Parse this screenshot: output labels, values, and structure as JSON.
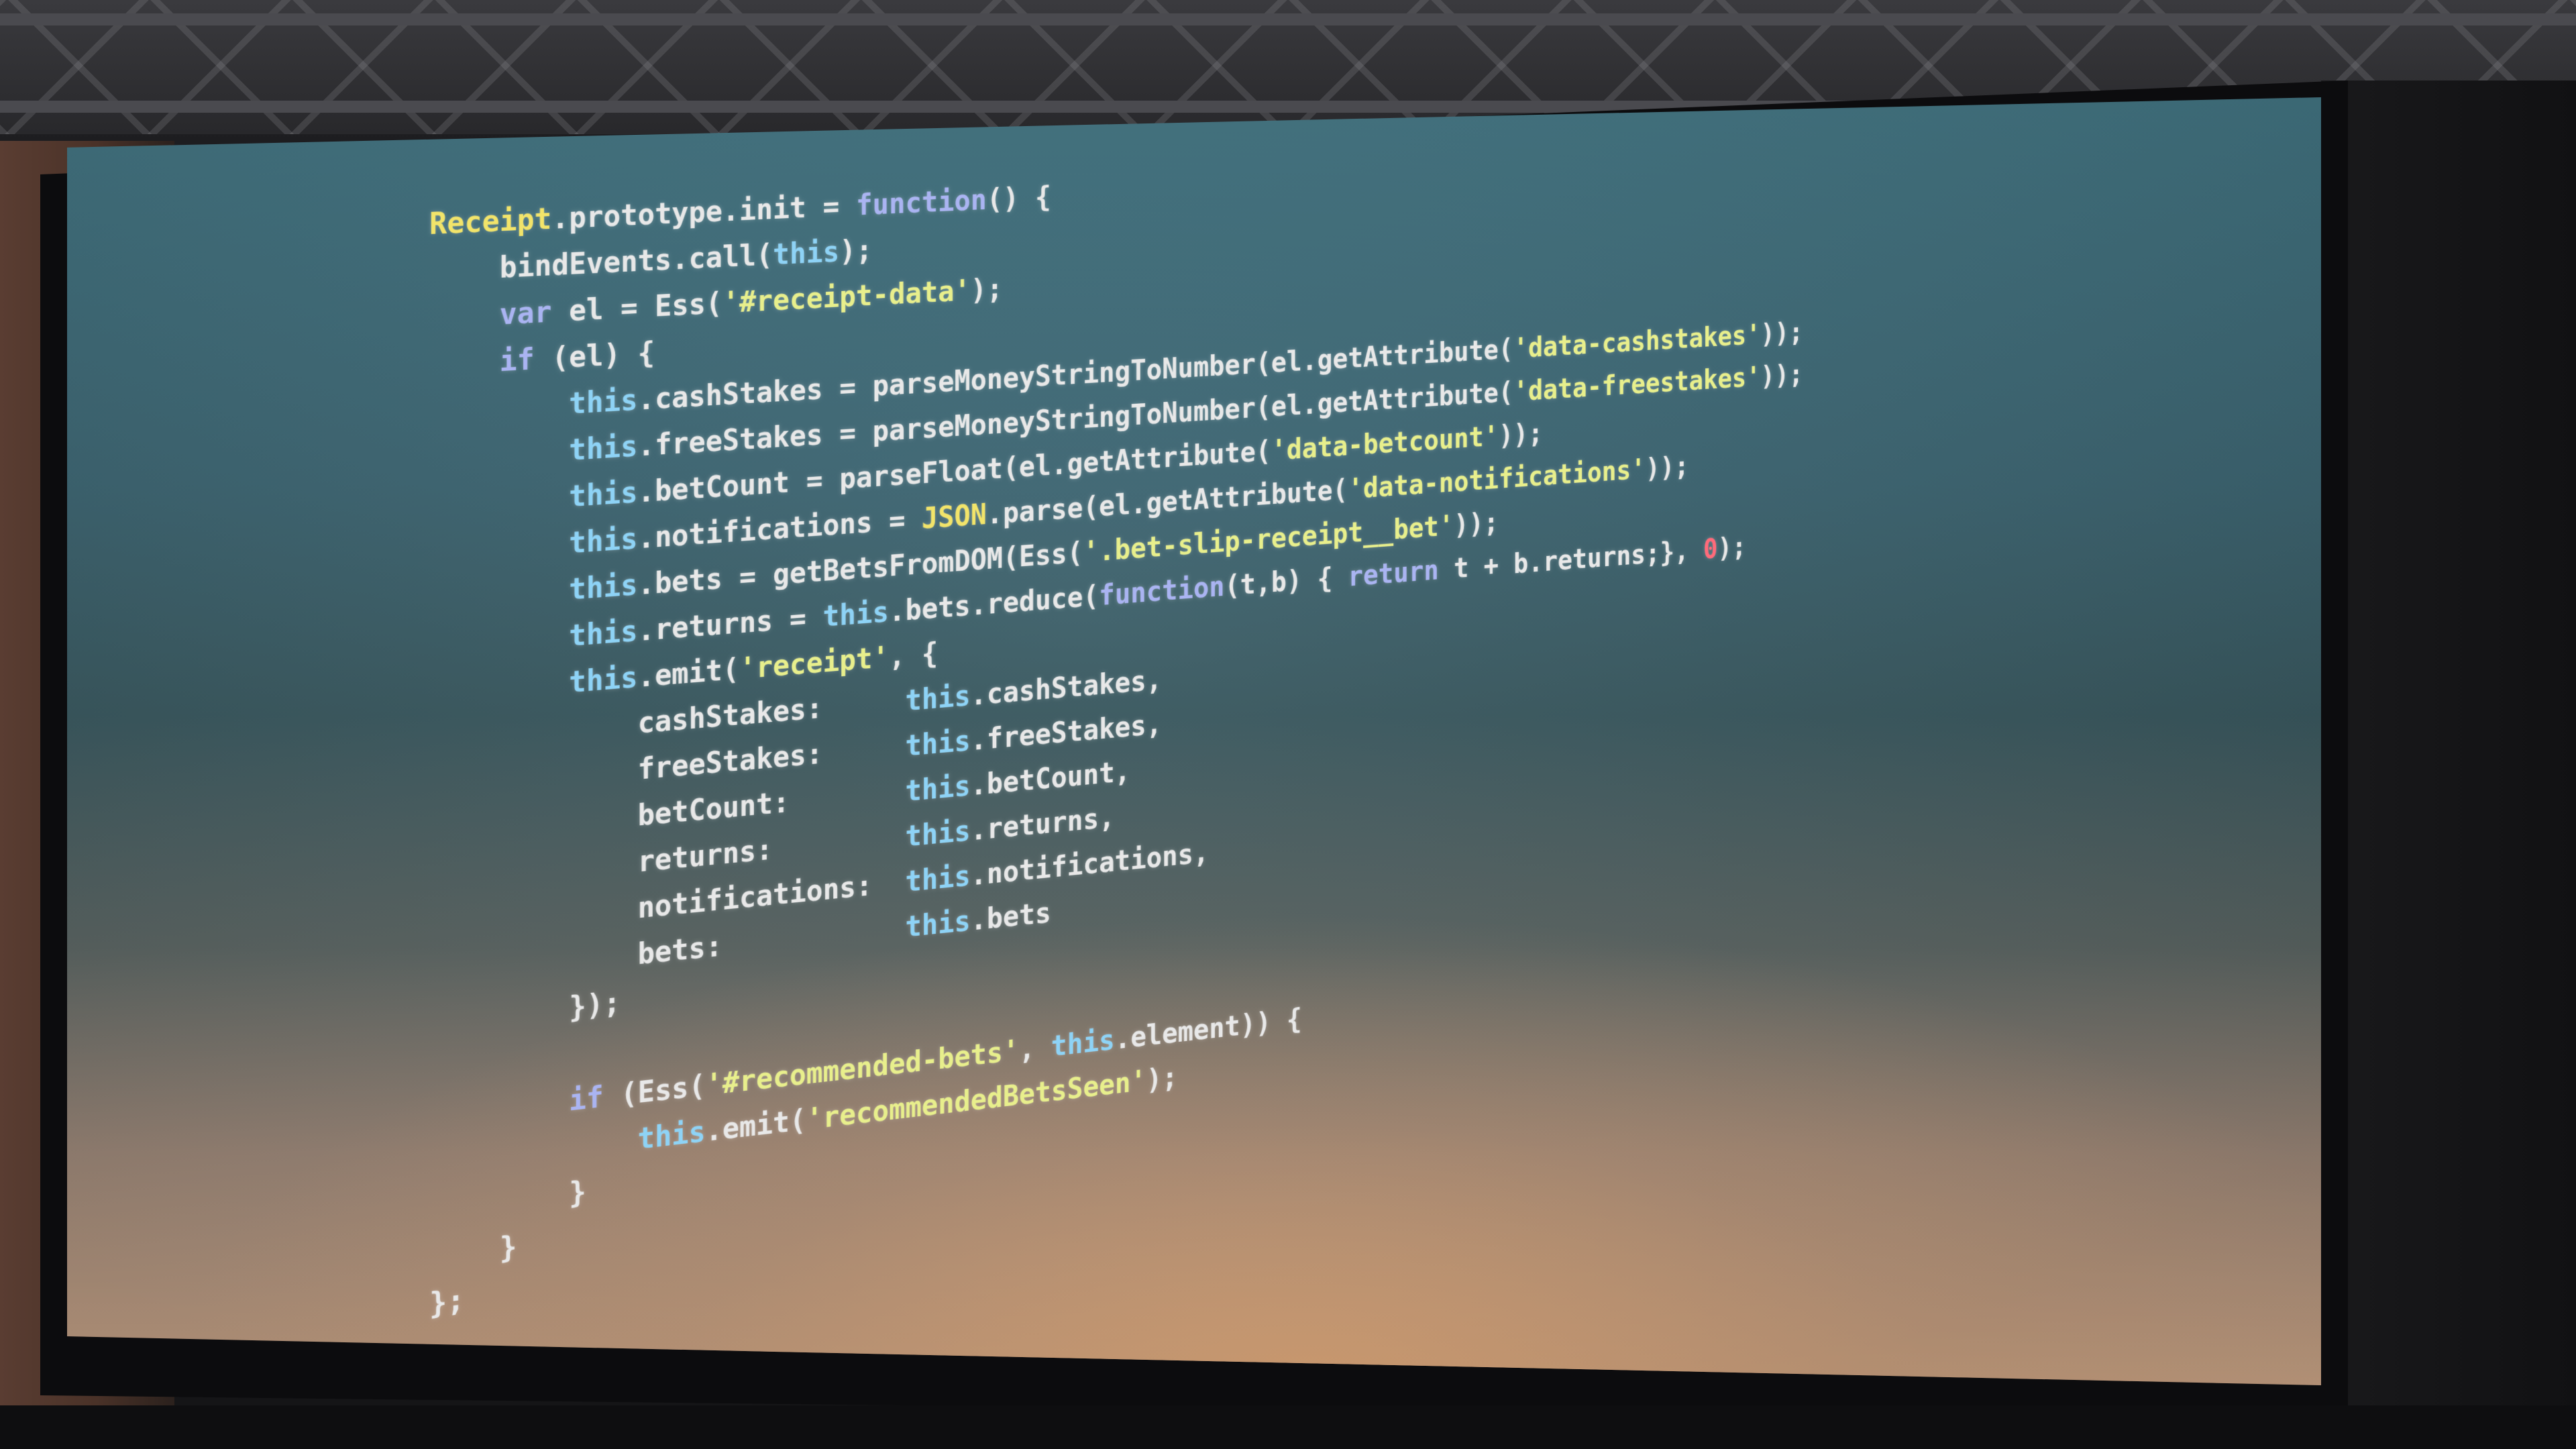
{
  "code_lines": [
    "Receipt.prototype.init = function() {",
    "    bindEvents.call(this);",
    "    var el = Ess('#receipt-data');",
    "    if (el) {",
    "        this.cashStakes = parseMoneyStringToNumber(el.getAttribute('data-cashstakes'));",
    "        this.freeStakes = parseMoneyStringToNumber(el.getAttribute('data-freestakes'));",
    "        this.betCount = parseFloat(el.getAttribute('data-betcount'));",
    "        this.notifications = JSON.parse(el.getAttribute('data-notifications'));",
    "        this.bets = getBetsFromDOM(Ess('.bet-slip-receipt__bet'));",
    "        this.returns = this.bets.reduce(function(t,b) { return t + b.returns;}, 0);",
    "        this.emit('receipt', {",
    "            cashStakes:     this.cashStakes,",
    "            freeStakes:     this.freeStakes,",
    "            betCount:       this.betCount,",
    "            returns:        this.returns,",
    "            notifications:  this.notifications,",
    "            bets:           this.bets",
    "        });",
    "",
    "        if (Ess('#recommended-bets', this.element)) {",
    "            this.emit('recommendedBetsSeen');",
    "        }",
    "    }",
    "};"
  ],
  "colors": {
    "object": "#f2e46a",
    "property": "#8ed3f6",
    "keyword": "#aab4f2",
    "string": "#e8ef8c",
    "number": "#ff6a7a"
  }
}
